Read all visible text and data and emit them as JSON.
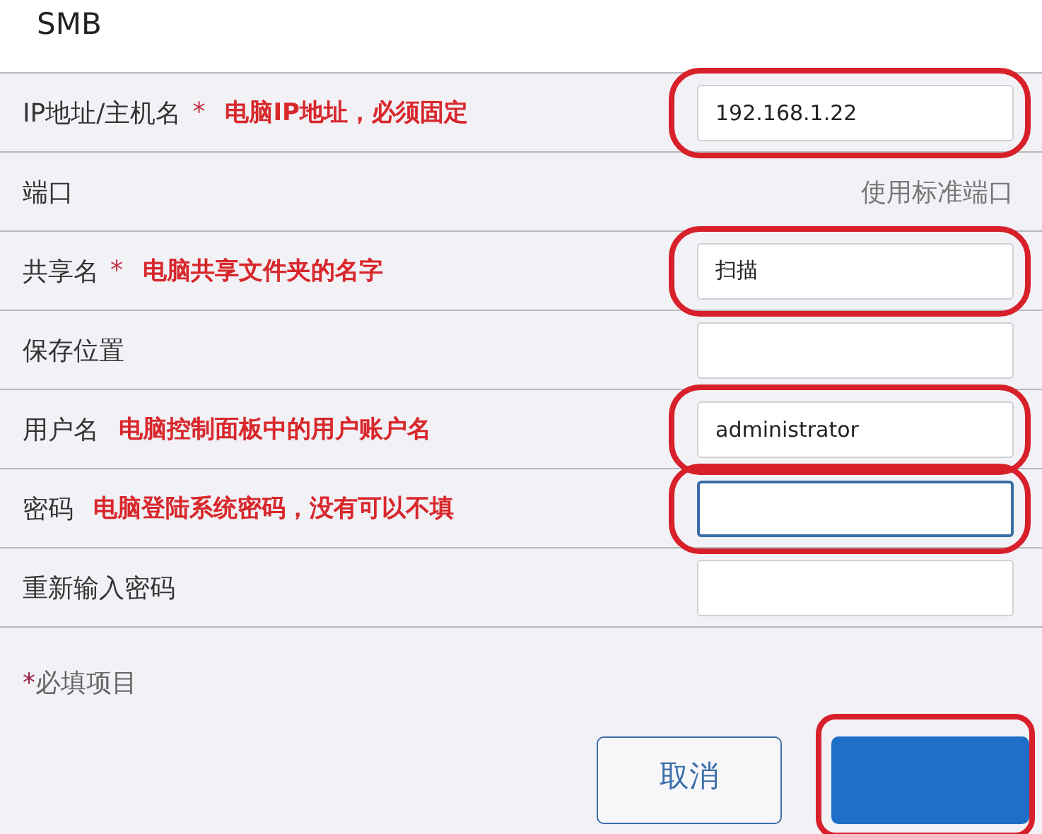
{
  "title": "SMB",
  "rows": [
    {
      "kind": "input",
      "label": "IP地址/主机名",
      "required": true,
      "note": "电脑IP地址，必须固定",
      "value": "192.168.1.22",
      "highlighted": true,
      "focused": false
    },
    {
      "kind": "text",
      "label": "端口",
      "value": "使用标准端口"
    },
    {
      "kind": "input",
      "label": "共享名",
      "required": true,
      "note": "电脑共享文件夹的名字",
      "value": "扫描",
      "highlighted": true,
      "focused": false
    },
    {
      "kind": "input",
      "label": "保存位置",
      "required": false,
      "highlighted": false,
      "focused": false
    },
    {
      "kind": "input",
      "label": "用户名",
      "required": false,
      "note": "电脑控制面板中的用户账户名",
      "value": "administrator",
      "highlighted": true,
      "focused": false
    },
    {
      "kind": "input",
      "label": "密码",
      "required": false,
      "note": "电脑登陆系统密码，没有可以不填",
      "highlighted": true,
      "focused": true
    },
    {
      "kind": "input",
      "label": "重新输入密码",
      "required": false,
      "highlighted": false,
      "focused": false
    }
  ],
  "required_note": {
    "mark": "*",
    "text": "必填项目"
  },
  "buttons": [
    {
      "kind": "secondary",
      "label": "取消",
      "highlighted": false
    },
    {
      "kind": "primary",
      "highlighted": true
    }
  ]
}
